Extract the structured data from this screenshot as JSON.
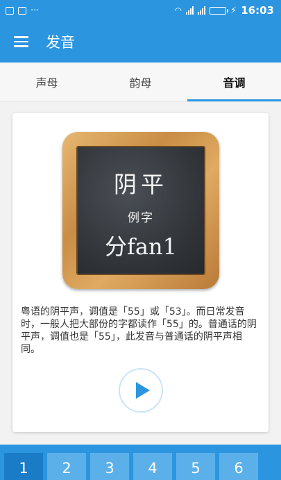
{
  "status_bar": {
    "time": "16:03",
    "dots": "···"
  },
  "app_bar": {
    "title": "发音"
  },
  "tabs": [
    {
      "label": "声母",
      "active": false
    },
    {
      "label": "韵母",
      "active": false
    },
    {
      "label": "音调",
      "active": true
    }
  ],
  "card": {
    "board": {
      "title": "阴平",
      "subtitle": "例字",
      "example": "分fan1"
    },
    "description": "粤语的阴平声，调值是「55」或「53」。而日常发音时，一般人把大部份的字都读作「55」的。普通话的阴平声，调值也是「55」，此发音与普通话的阴平声相同。"
  },
  "bottom_tabs": [
    "1",
    "2",
    "3",
    "4",
    "5",
    "6"
  ],
  "colors": {
    "primary": "#2b95e0",
    "tab_active": "#1a7cc7",
    "tab_inactive": "#5bb0ea"
  }
}
